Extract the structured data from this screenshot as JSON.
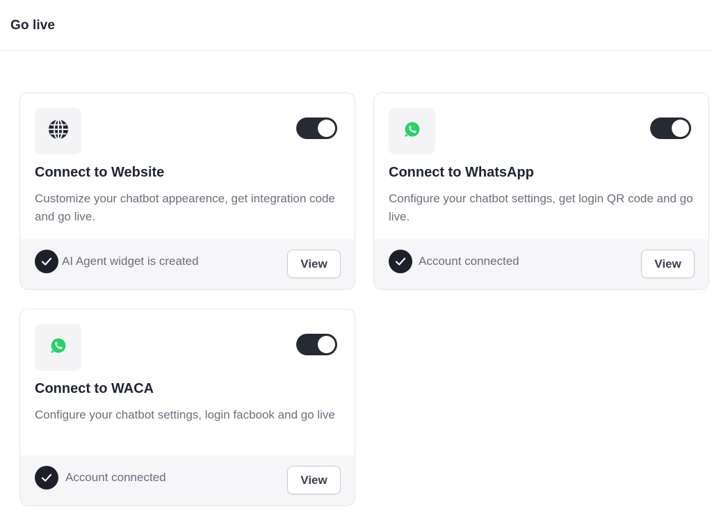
{
  "header": {
    "title": "Go live"
  },
  "colors": {
    "toggle_on": "#262a33",
    "check_circle": "#1d2029",
    "whatsapp_green": "#25d366",
    "footer_bg": "#f6f6f9",
    "muted_text": "#6a6f7c"
  },
  "cards": [
    {
      "icon": "globe-icon",
      "toggle_on": true,
      "title": "Connect to Website",
      "description": "Customize your chatbot appearence, get integration code and go live.",
      "status": "AI Agent widget is created",
      "button_label": "View"
    },
    {
      "icon": "whatsapp-icon",
      "toggle_on": true,
      "title": "Connect to WhatsApp",
      "description": "Configure your chatbot settings, get login QR code and go live.",
      "status": "Account connected",
      "button_label": "View"
    },
    {
      "icon": "whatsapp-icon",
      "toggle_on": true,
      "title": "Connect to WACA",
      "description": "Configure your chatbot settings, login facbook and go live",
      "status": "Account connected",
      "button_label": "View"
    }
  ]
}
